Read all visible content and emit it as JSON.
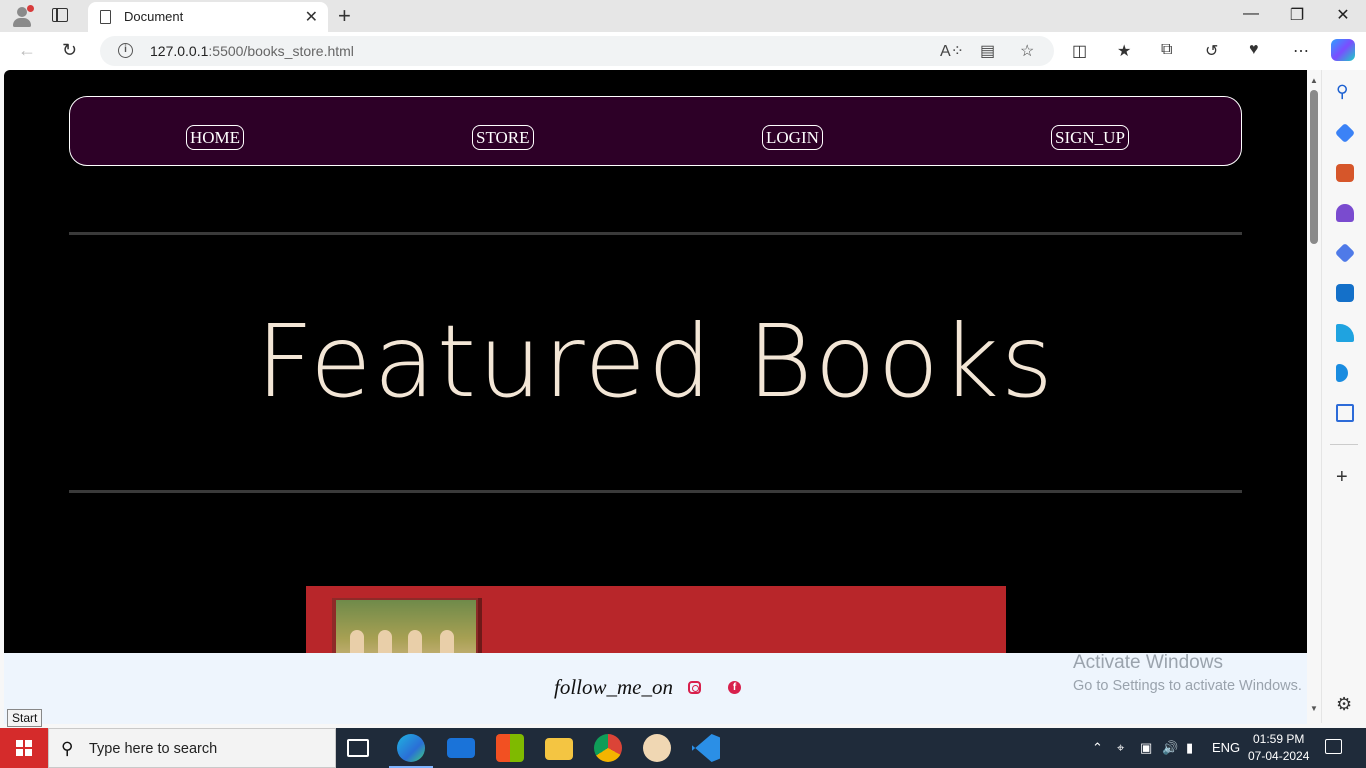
{
  "browser": {
    "tab_title": "Document",
    "url_host": "127.0.0.1",
    "url_rest": ":5500/books_store.html",
    "new_tab_symbol": "+",
    "close_tab_symbol": "✕"
  },
  "nav": {
    "home": "HOME",
    "store": "STORE",
    "login": "LOGIN",
    "signup": "SIGN_UP"
  },
  "hero": {
    "title": "Featured Books"
  },
  "footer": {
    "follow_text": "follow_me_on",
    "facebook_glyph": "f"
  },
  "watermark": {
    "line1": "Activate Windows",
    "line2": "Go to Settings to activate Windows."
  },
  "tooltip": {
    "start": "Start"
  },
  "taskbar": {
    "search_placeholder": "Type here to search",
    "language": "ENG",
    "time": "01:59 PM",
    "date": "07-04-2024"
  },
  "colors": {
    "page_bg": "#000000",
    "navbar_bg": "#2d0027",
    "hero_text": "#f3e6d6",
    "book_card": "#b8262a",
    "footer_bg": "#eef5fd",
    "social_icon": "#d8204c"
  }
}
